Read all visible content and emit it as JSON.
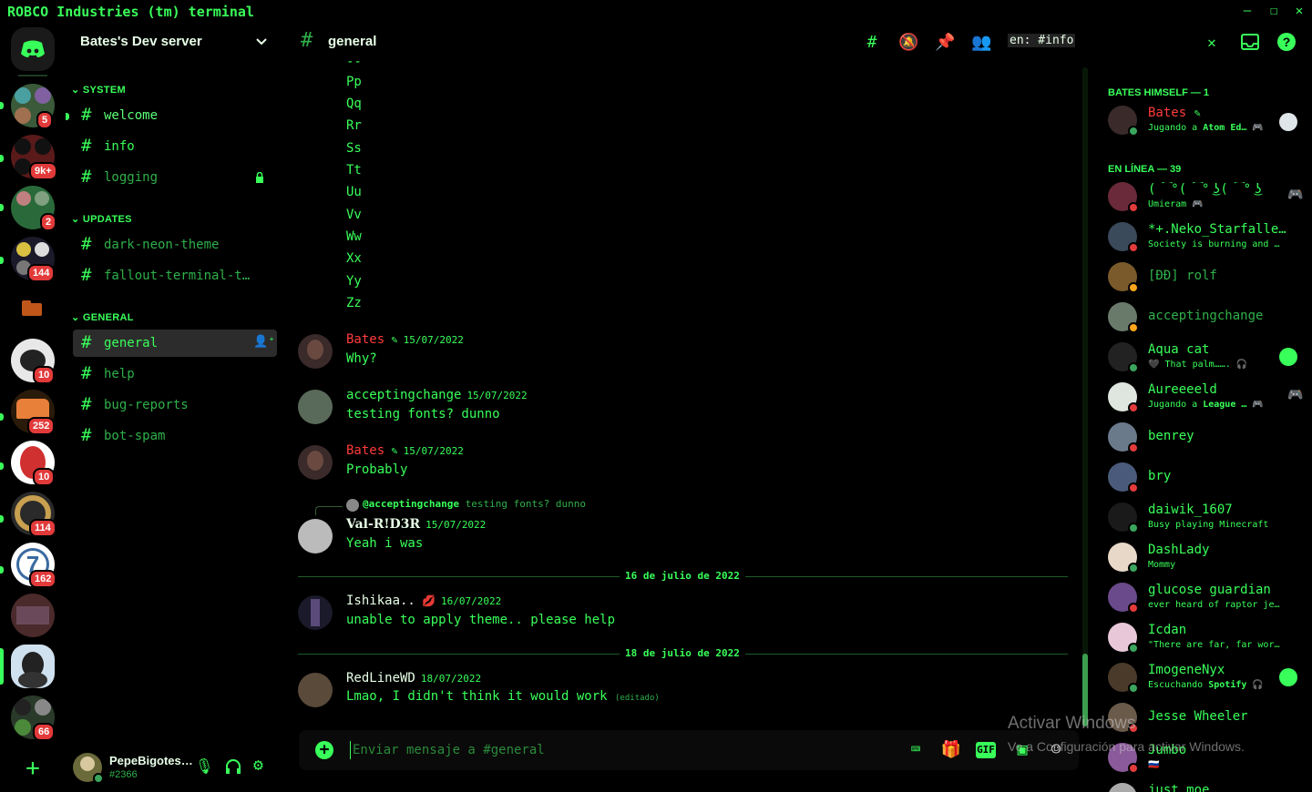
{
  "window": {
    "title": "ROBCO Industries (tm) terminal",
    "minimize": "–",
    "maximize": "☐",
    "close": "✕"
  },
  "server": {
    "name": "Bates's Dev server"
  },
  "server_badges": [
    "5",
    "9k+",
    "2",
    "144",
    "10",
    "252",
    "10",
    "114",
    "162",
    "66"
  ],
  "categories": {
    "system": "SYSTEM",
    "updates": "UPDATES",
    "general": "GENERAL"
  },
  "channels": {
    "welcome": "welcome",
    "info": "info",
    "logging": "logging",
    "dark_neon": "dark-neon-theme",
    "fallout": "fallout-terminal-t…",
    "general": "general",
    "help": "help",
    "bug_reports": "bug-reports",
    "bot_spam": "bot-spam"
  },
  "user": {
    "name": "PepeBigotes…",
    "tag": "#2366"
  },
  "header": {
    "channel": "general",
    "search_value": "en: #info"
  },
  "letters": [
    "Pp",
    "Qq",
    "Rr",
    "Ss",
    "Tt",
    "Uu",
    "Vv",
    "Ww",
    "Xx",
    "Yy",
    "Zz"
  ],
  "messages": [
    {
      "author": "Bates",
      "date": "15/07/2022",
      "text": "Why?"
    },
    {
      "author": "acceptingchange",
      "date": "15/07/2022",
      "text": "testing fonts? dunno"
    },
    {
      "author": "Bates",
      "date": "15/07/2022",
      "text": "Probably"
    },
    {
      "reply_author": "@acceptingchange",
      "reply_text": "testing fonts? dunno",
      "author": "Val-R!D3R",
      "date": "15/07/2022",
      "text": "Yeah i was"
    },
    {
      "author": "Ishikaa..",
      "date": "16/07/2022",
      "text": "unable to apply theme.. please help"
    },
    {
      "author": "RedLineWD",
      "date": "18/07/2022",
      "text": "Lmao, I didn't think it would work",
      "edited": "(editado)"
    }
  ],
  "dividers": [
    "16 de julio de 2022",
    "18 de julio de 2022"
  ],
  "composer": {
    "placeholder": "Enviar mensaje a #general"
  },
  "member_list": {
    "cat_bates": "BATES HIMSELF — 1",
    "cat_online": "EN LÍNEA — 39",
    "members": [
      {
        "name": "Bates",
        "activity_pre": "Jugando a ",
        "activity_bold": "Atom Ed…"
      },
      {
        "name": "( ͡°( ͡° ͜ʖ( ͡° ͜ʖ ͡°)ʖ ͡°) ͡°)",
        "activity_pre": "Umieram",
        "activity_bold": ""
      },
      {
        "name": "*+.Neko_Starfalle…",
        "activity_pre": "Society is burning and …",
        "activity_bold": ""
      },
      {
        "name": "[ÐÐ] rolf",
        "activity_pre": "",
        "activity_bold": ""
      },
      {
        "name": "acceptingchange",
        "activity_pre": "",
        "activity_bold": ""
      },
      {
        "name": "Aqua cat",
        "activity_pre": "That palm…….",
        "activity_bold": ""
      },
      {
        "name": "Aureeeeld",
        "activity_pre": "Jugando a ",
        "activity_bold": "League …"
      },
      {
        "name": "benrey",
        "activity_pre": "",
        "activity_bold": ""
      },
      {
        "name": "bry",
        "activity_pre": "",
        "activity_bold": ""
      },
      {
        "name": "daiwik_1607",
        "activity_pre": "Busy playing Minecraft",
        "activity_bold": ""
      },
      {
        "name": "DashLady",
        "activity_pre": "Mommy",
        "activity_bold": ""
      },
      {
        "name": "glucose guardian",
        "activity_pre": "ever heard of raptor je…",
        "activity_bold": ""
      },
      {
        "name": "Icdan",
        "activity_pre": "\"There are far, far wor…",
        "activity_bold": ""
      },
      {
        "name": "ImogeneNyx",
        "activity_pre": "Escuchando ",
        "activity_bold": "Spotify"
      },
      {
        "name": "Jesse Wheeler",
        "activity_pre": "",
        "activity_bold": ""
      },
      {
        "name": "Jumbo",
        "activity_pre": "",
        "activity_bold": ""
      },
      {
        "name": "just_moe",
        "activity_pre": "",
        "activity_bold": ""
      }
    ]
  },
  "watermark": {
    "line1": "Activar Windows",
    "line2": "Ve a Configuración para activar Windows."
  },
  "colors": {
    "accent": "#39ff5a",
    "background": "#000000",
    "name_red": "#ff3b3b",
    "dnd": "#e23a3a",
    "online": "#3ba55d",
    "idle": "#faa61a"
  }
}
